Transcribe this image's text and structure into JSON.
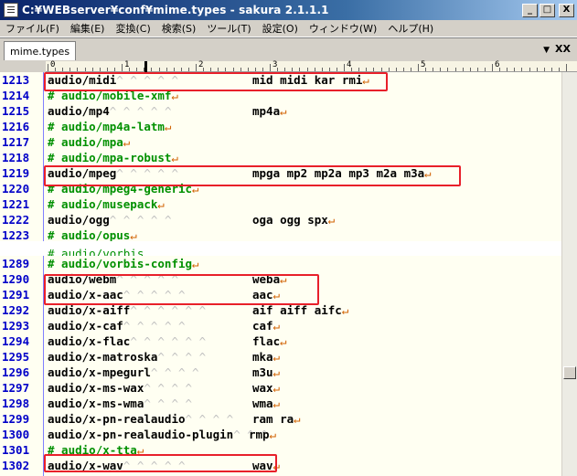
{
  "window": {
    "title": "C:¥WEBserver¥conf¥mime.types - sakura 2.1.1.1",
    "minimize": "_",
    "maximize": "□",
    "close": "X"
  },
  "menu": [
    "ファイル(F)",
    "編集(E)",
    "変換(C)",
    "検索(S)",
    "ツール(T)",
    "設定(O)",
    "ウィンドウ(W)",
    "ヘルプ(H)"
  ],
  "tabs": {
    "active": "mime.types",
    "dropdown": "▼",
    "close": "XX"
  },
  "ruler": {
    "labels": [
      "0",
      "1",
      "2",
      "3",
      "4",
      "5",
      "6"
    ]
  },
  "top_pane": {
    "lines": [
      {
        "num": "1213",
        "type": "code",
        "text": "audio/midi",
        "tabs": "^ ^ ^ ^ ^",
        "ext": "mid midi kar rmi"
      },
      {
        "num": "1214",
        "type": "comment",
        "text": "# audio/mobile-xmf"
      },
      {
        "num": "1215",
        "type": "code",
        "text": "audio/mp4",
        "tabs": "^ ^ ^ ^ ^",
        "ext": "mp4a"
      },
      {
        "num": "1216",
        "type": "comment",
        "text": "# audio/mp4a-latm"
      },
      {
        "num": "1217",
        "type": "comment",
        "text": "# audio/mpa"
      },
      {
        "num": "1218",
        "type": "comment",
        "text": "# audio/mpa-robust"
      },
      {
        "num": "1219",
        "type": "code",
        "text": "audio/mpeg",
        "tabs": "^ ^ ^ ^ ^",
        "ext": "mpga mp2 mp2a mp3 m2a m3a"
      },
      {
        "num": "1220",
        "type": "comment",
        "text": "# audio/mpeg4-generic"
      },
      {
        "num": "1221",
        "type": "comment",
        "text": "# audio/musepack"
      },
      {
        "num": "1222",
        "type": "code",
        "text": "audio/ogg",
        "tabs": "^ ^ ^ ^ ^",
        "ext": "oga ogg spx"
      },
      {
        "num": "1223",
        "type": "comment",
        "text": "# audio/opus"
      }
    ]
  },
  "bottom_pane": {
    "lines": [
      {
        "num": "1289",
        "type": "comment",
        "text": "# audio/vorbis-config"
      },
      {
        "num": "1290",
        "type": "code",
        "text": "audio/webm",
        "tabs": "^ ^ ^ ^ ^",
        "ext": "weba"
      },
      {
        "num": "1291",
        "type": "code",
        "text": "audio/x-aac",
        "tabs": "^ ^ ^ ^ ^",
        "ext": "aac"
      },
      {
        "num": "1292",
        "type": "code",
        "text": "audio/x-aiff",
        "tabs": "^ ^ ^ ^ ^ ^",
        "ext": "aif aiff aifc"
      },
      {
        "num": "1293",
        "type": "code",
        "text": "audio/x-caf",
        "tabs": "^ ^ ^ ^ ^",
        "ext": "caf"
      },
      {
        "num": "1294",
        "type": "code",
        "text": "audio/x-flac",
        "tabs": "^ ^ ^ ^ ^ ^",
        "ext": "flac"
      },
      {
        "num": "1295",
        "type": "code",
        "text": "audio/x-matroska",
        "tabs": "^ ^ ^ ^",
        "ext": "mka"
      },
      {
        "num": "1296",
        "type": "code",
        "text": "audio/x-mpegurl",
        "tabs": "^ ^ ^ ^",
        "ext": "m3u"
      },
      {
        "num": "1297",
        "type": "code",
        "text": "audio/x-ms-wax",
        "tabs": "^ ^ ^ ^",
        "ext": "wax"
      },
      {
        "num": "1298",
        "type": "code",
        "text": "audio/x-ms-wma",
        "tabs": "^ ^ ^ ^",
        "ext": "wma"
      },
      {
        "num": "1299",
        "type": "code",
        "text": "audio/x-pn-realaudio",
        "tabs": "^ ^ ^ ^",
        "ext": "ram ra"
      },
      {
        "num": "1300",
        "type": "code",
        "text": "audio/x-pn-realaudio-plugin",
        "tabs": "^ ^ ^",
        "ext": "rmp"
      },
      {
        "num": "1301",
        "type": "comment",
        "text": "# audio/x-tta"
      },
      {
        "num": "1302",
        "type": "code",
        "text": "audio/x-wav",
        "tabs": "^ ^ ^ ^ ^",
        "ext": "wav"
      }
    ]
  },
  "eol_mark": "↵",
  "partial_top_text": "# audio/vorbis"
}
